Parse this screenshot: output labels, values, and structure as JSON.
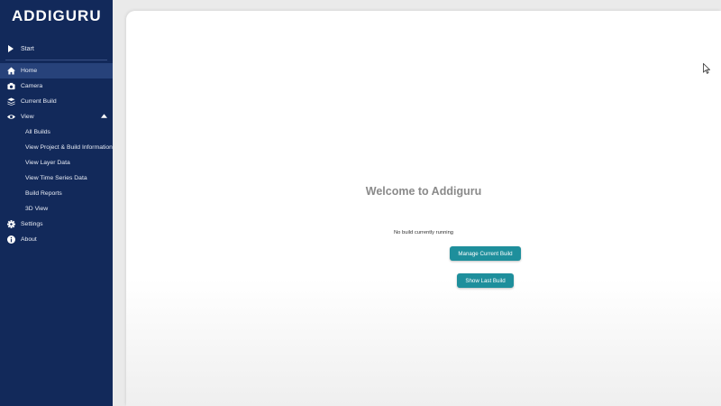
{
  "brand": {
    "logo": "ADDIGURU"
  },
  "sidebar": {
    "start_label": "Start",
    "items": [
      {
        "label": "Home",
        "icon": "home-icon",
        "active": true
      },
      {
        "label": "Camera",
        "icon": "camera-icon"
      },
      {
        "label": "Current Build",
        "icon": "layers-icon"
      },
      {
        "label": "View",
        "icon": "eye-icon",
        "expanded": true
      },
      {
        "label": "Settings",
        "icon": "gear-icon"
      },
      {
        "label": "About",
        "icon": "info-icon"
      }
    ],
    "view_subitems": [
      "All Builds",
      "View Project & Build Information",
      "View Layer Data",
      "View Time Series Data",
      "Build Reports",
      "3D View"
    ]
  },
  "main": {
    "welcome_title": "Welcome to Addiguru",
    "status_text": "No build currently running",
    "manage_button": "Manage Current Build",
    "last_build_button": "Show Last Build"
  },
  "colors": {
    "sidebar_bg": "#12295a",
    "active_item_bg": "#27427a",
    "accent_button": "#1e8f9c"
  }
}
